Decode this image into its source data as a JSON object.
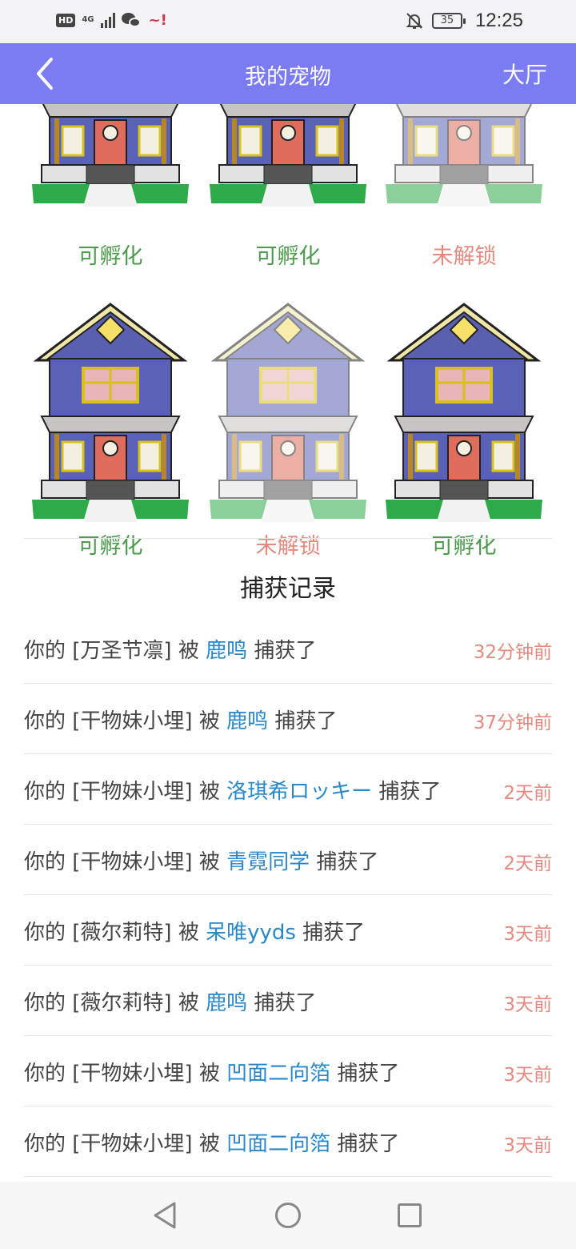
{
  "status_bar": {
    "hd": "HD",
    "network": "4G",
    "battery": "35",
    "time": "12:25"
  },
  "header": {
    "title": "我的宠物",
    "right_action": "大厅"
  },
  "houses": [
    {
      "status": "可孵化",
      "state": "hatchable"
    },
    {
      "status": "可孵化",
      "state": "hatchable"
    },
    {
      "status": "未解锁",
      "state": "locked"
    },
    {
      "status": "可孵化",
      "state": "hatchable"
    },
    {
      "status": "未解锁",
      "state": "locked"
    },
    {
      "status": "可孵化",
      "state": "hatchable"
    }
  ],
  "records_title": "捕获记录",
  "records": [
    {
      "prefix": "你的 [万圣节凛] 被 ",
      "catcher": "鹿鸣",
      "suffix": " 捕获了",
      "time": "32分钟前"
    },
    {
      "prefix": "你的 [干物妹小埋] 被 ",
      "catcher": "鹿鸣",
      "suffix": " 捕获了",
      "time": "37分钟前"
    },
    {
      "prefix": "你的 [干物妹小埋] 被 ",
      "catcher": "洛琪希ロッキー",
      "suffix": " 捕获了",
      "time": "2天前"
    },
    {
      "prefix": "你的 [干物妹小埋] 被 ",
      "catcher": "青霓同学",
      "suffix": " 捕获了",
      "time": "2天前"
    },
    {
      "prefix": "你的 [薇尔莉特] 被 ",
      "catcher": "呆唯yyds",
      "suffix": " 捕获了",
      "time": "3天前"
    },
    {
      "prefix": "你的 [薇尔莉特] 被 ",
      "catcher": "鹿鸣",
      "suffix": " 捕获了",
      "time": "3天前"
    },
    {
      "prefix": "你的 [干物妹小埋] 被 ",
      "catcher": "凹面二向箔",
      "suffix": " 捕获了",
      "time": "3天前"
    },
    {
      "prefix": "你的 [干物妹小埋] 被 ",
      "catcher": "凹面二向箔",
      "suffix": " 捕获了",
      "time": "3天前"
    }
  ],
  "colors": {
    "header_bg": "#7b7cf2",
    "hatchable": "#4c9a4c",
    "locked": "#e48a7f",
    "catcher_link": "#2a87c8"
  },
  "icons": {
    "back": "back-chevron-icon",
    "house": "house-icon",
    "nav_back": "nav-back-triangle-icon",
    "nav_home": "nav-home-circle-icon",
    "nav_recent": "nav-recent-square-icon"
  }
}
